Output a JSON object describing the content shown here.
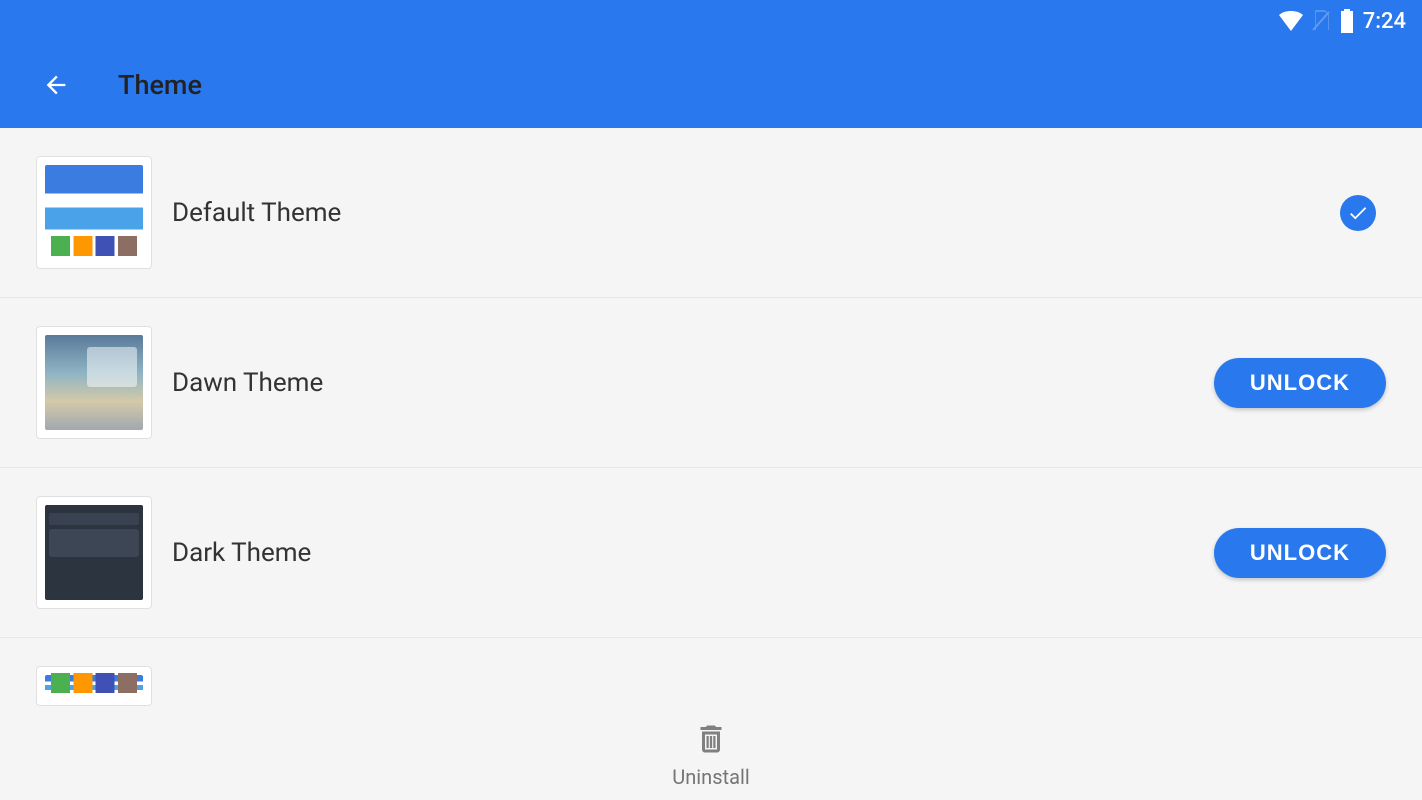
{
  "status": {
    "time": "7:24"
  },
  "header": {
    "title": "Theme"
  },
  "themes": [
    {
      "name": "Default Theme",
      "selected": true,
      "locked": false,
      "thumbClass": "thumb-default"
    },
    {
      "name": "Dawn Theme",
      "selected": false,
      "locked": true,
      "thumbClass": "thumb-dawn"
    },
    {
      "name": "Dark Theme",
      "selected": false,
      "locked": true,
      "thumbClass": "thumb-dark"
    }
  ],
  "actions": {
    "unlock_label": "UNLOCK"
  },
  "footer": {
    "uninstall_label": "Uninstall"
  }
}
